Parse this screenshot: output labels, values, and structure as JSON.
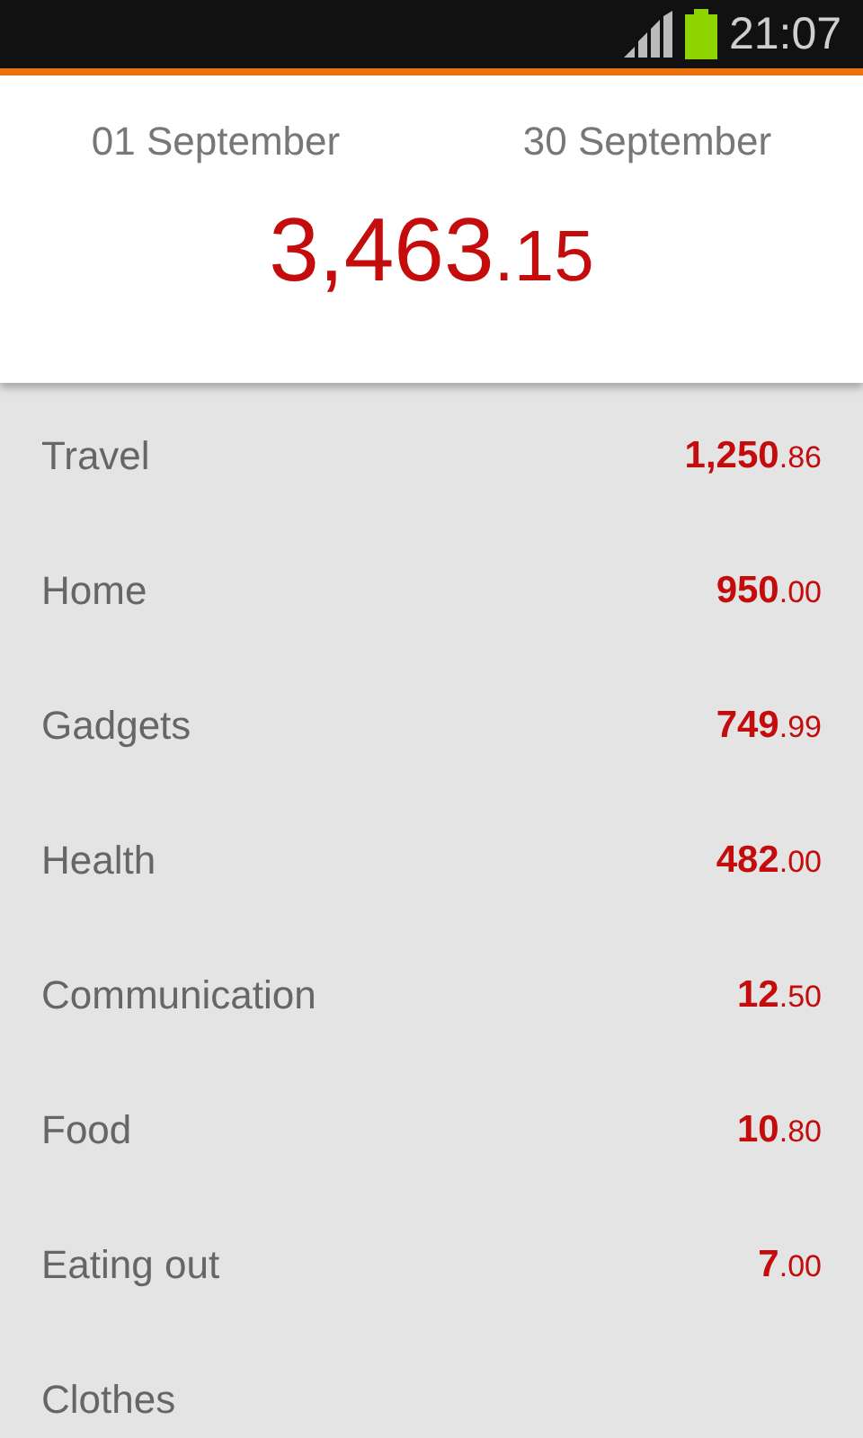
{
  "status_bar": {
    "time": "21:07"
  },
  "header": {
    "start_date": "01 September",
    "end_date": "30 September",
    "total_whole": "3,463",
    "total_fraction": ".15"
  },
  "categories": [
    {
      "name": "Travel",
      "amount_whole": "1,250",
      "amount_fraction": ".86"
    },
    {
      "name": "Home",
      "amount_whole": "950",
      "amount_fraction": ".00"
    },
    {
      "name": "Gadgets",
      "amount_whole": "749",
      "amount_fraction": ".99"
    },
    {
      "name": "Health",
      "amount_whole": "482",
      "amount_fraction": ".00"
    },
    {
      "name": "Communication",
      "amount_whole": "12",
      "amount_fraction": ".50"
    },
    {
      "name": "Food",
      "amount_whole": "10",
      "amount_fraction": ".80"
    },
    {
      "name": "Eating out",
      "amount_whole": "7",
      "amount_fraction": ".00"
    },
    {
      "name": "Clothes"
    }
  ]
}
